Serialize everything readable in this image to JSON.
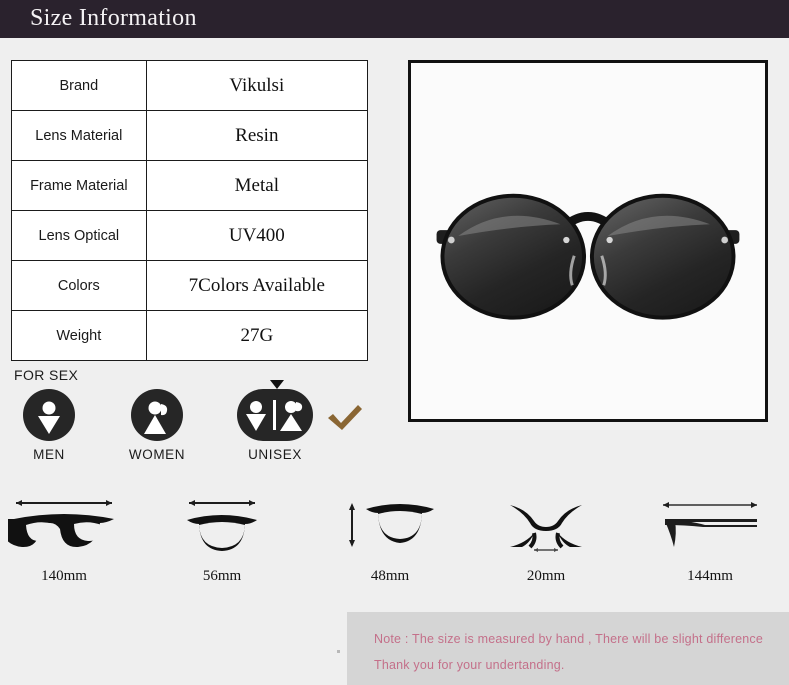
{
  "header": {
    "title": "Size Information"
  },
  "spec_table": {
    "rows": [
      {
        "key": "Brand",
        "value": "Vikulsi"
      },
      {
        "key": "Lens Material",
        "value": "Resin"
      },
      {
        "key": "Frame Material",
        "value": "Metal"
      },
      {
        "key": "Lens Optical",
        "value": "UV400"
      },
      {
        "key": "Colors",
        "value": "7Colors Available"
      },
      {
        "key": "Weight",
        "value": "27G"
      }
    ]
  },
  "product_image": {
    "alt": "black round polarized sunglasses front view",
    "frame_color": "#111111",
    "background": "#fbfbfb"
  },
  "for_sex": {
    "label": "FOR SEX",
    "options": [
      {
        "caption": "MEN",
        "icon": "male-figure-icon",
        "selected": false
      },
      {
        "caption": "WOMEN",
        "icon": "female-figure-icon",
        "selected": false
      },
      {
        "caption": "UNISEX",
        "icon": "unisex-figures-icon",
        "selected": true
      }
    ],
    "selected_marker": "down-triangle-marker",
    "check_icon": "checkmark-icon",
    "check_color": "#8a6633",
    "badge_color": "#262626"
  },
  "measurements": [
    {
      "label": "140mm",
      "icon": "frame-total-width-icon",
      "dimension": "total frame width"
    },
    {
      "label": "56mm",
      "icon": "lens-width-icon",
      "dimension": "lens width"
    },
    {
      "label": "48mm",
      "icon": "lens-height-icon",
      "dimension": "lens height"
    },
    {
      "label": "20mm",
      "icon": "bridge-width-icon",
      "dimension": "bridge width"
    },
    {
      "label": "144mm",
      "icon": "temple-length-icon",
      "dimension": "temple length"
    }
  ],
  "note": {
    "line1": "Note : The size is measured by hand , There will be slight difference",
    "line2": "Thank you for your undertanding.",
    "text_color": "#c4708a",
    "background": "#d5d5d5"
  }
}
